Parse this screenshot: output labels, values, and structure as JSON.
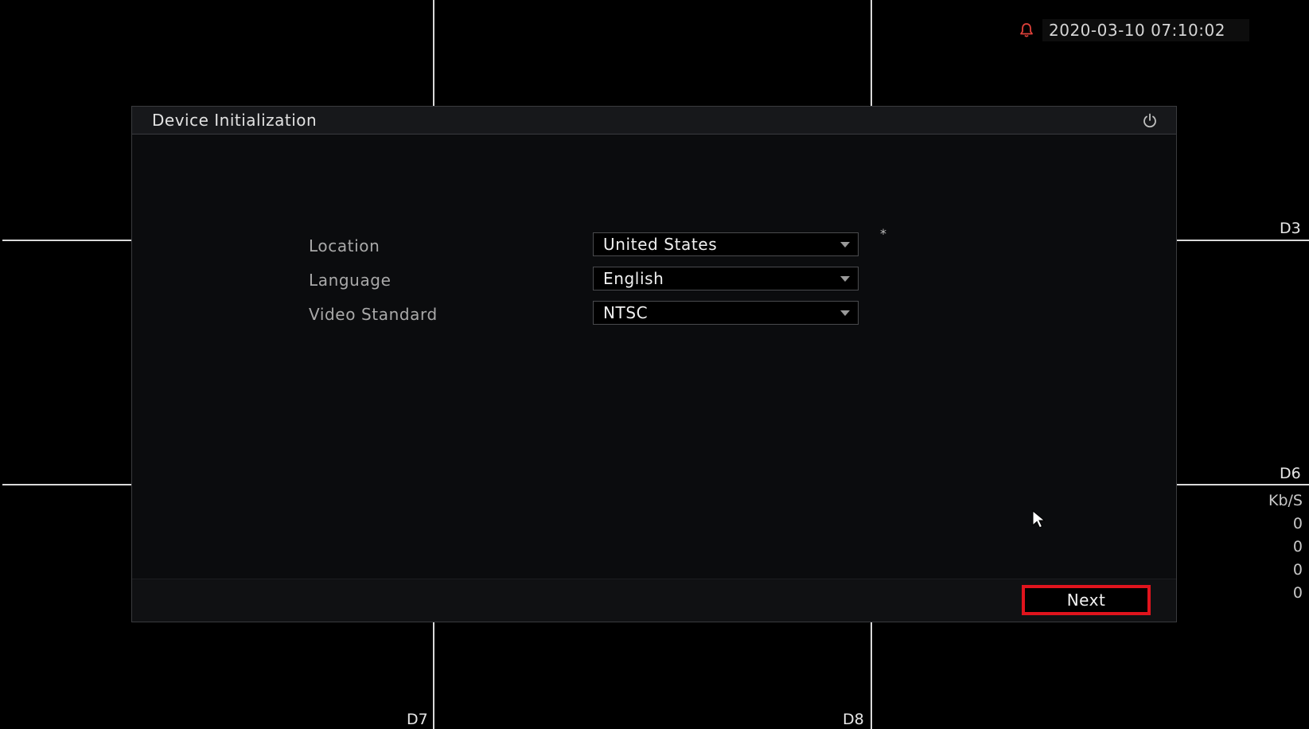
{
  "status_bar": {
    "datetime": "2020-03-10 07:10:02",
    "alarm_color": "#e0413a"
  },
  "channels": {
    "labels": [
      "D3",
      "D6",
      "D7",
      "D8"
    ],
    "bitrate_unit": "Kb/S",
    "bitrates": [
      "0",
      "0",
      "0",
      "0"
    ]
  },
  "dialog": {
    "title": "Device Initialization",
    "fields": [
      {
        "label": "Location",
        "value": "United States"
      },
      {
        "label": "Language",
        "value": "English"
      },
      {
        "label": "Video Standard",
        "value": "NTSC"
      }
    ],
    "required_mark": "*",
    "next_label": "Next",
    "highlight_color": "#e0141d"
  }
}
